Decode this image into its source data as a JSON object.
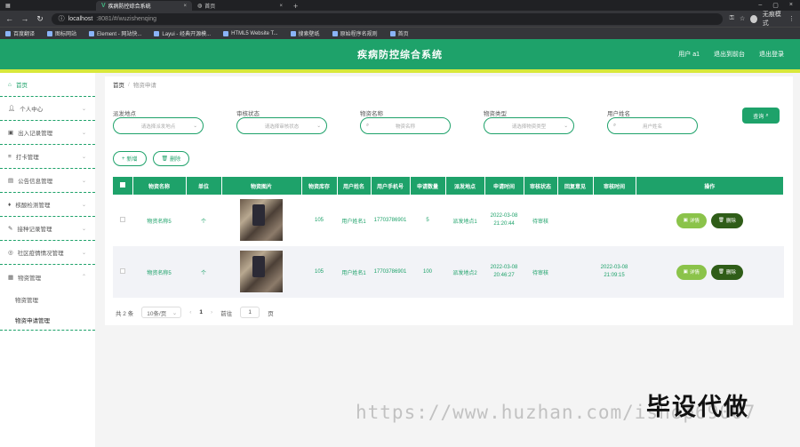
{
  "browser": {
    "tabs": [
      {
        "label": "疾病防控综合系统",
        "active": true
      },
      {
        "label": "首页",
        "active": false
      }
    ],
    "url": {
      "host": "localhost",
      "rest": ":8081/#/wuzishenqing"
    },
    "profile_label": "无痕模式",
    "bookmarks": [
      "百度翻译",
      "图标网站",
      "Element - 网站快...",
      "Layui - 经典开源模...",
      "HTML5 Website T...",
      "搜索壁纸",
      "原始程序名规则",
      "首页"
    ]
  },
  "header": {
    "title": "疾病防控综合系统",
    "user": "用户 a1",
    "exit_to_front": "退出到前台",
    "logout": "退出登录"
  },
  "sidebar": {
    "items": [
      {
        "label": "首页",
        "icon": "home-icon",
        "active": true
      },
      {
        "label": "个人中心",
        "icon": "user-icon"
      },
      {
        "label": "出入记录管理",
        "icon": "lock-icon"
      },
      {
        "label": "打卡管理",
        "icon": "list-icon"
      },
      {
        "label": "公告信息管理",
        "icon": "doc-icon"
      },
      {
        "label": "核酸检测管理",
        "icon": "mic-icon"
      },
      {
        "label": "接种记录管理",
        "icon": "needle-icon"
      },
      {
        "label": "社区疫情情况管理",
        "icon": "globe-icon"
      },
      {
        "label": "物资管理",
        "icon": "box-icon"
      }
    ],
    "sub_items": [
      {
        "label": "物资管理"
      },
      {
        "label": "物资申请管理",
        "active": true
      }
    ]
  },
  "breadcrumb": {
    "home": "首页",
    "sep": "/",
    "current": "物资申请"
  },
  "filters": [
    {
      "label": "派发地点",
      "placeholder": "请选择派发地点",
      "type": "select"
    },
    {
      "label": "审核状态",
      "placeholder": "请选择审核状态",
      "type": "select"
    },
    {
      "label": "物资名称",
      "placeholder": "物资名称",
      "type": "input"
    },
    {
      "label": "物资类型",
      "placeholder": "请选择物资类型",
      "type": "select"
    },
    {
      "label": "用户姓名",
      "placeholder": "用户姓名",
      "type": "input"
    }
  ],
  "query_label": "查询",
  "add_label": "新增",
  "delete_label": "删除",
  "table": {
    "columns": [
      "物资名称",
      "单位",
      "物资图片",
      "物资库存",
      "用户姓名",
      "用户手机号",
      "申请数量",
      "派发地点",
      "申请时间",
      "审核状态",
      "回复意见",
      "审核时间",
      "操作"
    ],
    "rows": [
      {
        "name": "物资名称5",
        "unit": "个",
        "stock": "105",
        "user": "用户姓名1",
        "phone": "17703786901",
        "qty": "5",
        "place": "派发地点1",
        "apply_time": "2022-03-08 21:20:44",
        "status": "待审核",
        "reply": "",
        "review_time": ""
      },
      {
        "name": "物资名称5",
        "unit": "个",
        "stock": "105",
        "user": "用户姓名1",
        "phone": "17703786901",
        "qty": "100",
        "place": "派发地点2",
        "apply_time": "2022-03-08 20:46:27",
        "status": "待审核",
        "reply": "",
        "review_time": "2022-03-08 21:09:15"
      }
    ],
    "detail_label": "详情",
    "row_delete_label": "删除"
  },
  "pagination": {
    "total": "共 2 条",
    "page_size": "10条/页",
    "prev": "‹",
    "page": "1",
    "next": "›",
    "goto": "前往",
    "goto_value": "1",
    "page_unit": "页"
  },
  "watermark": {
    "url": "https://www.huzhan.com/ishop69007",
    "brand": "毕设代做"
  }
}
